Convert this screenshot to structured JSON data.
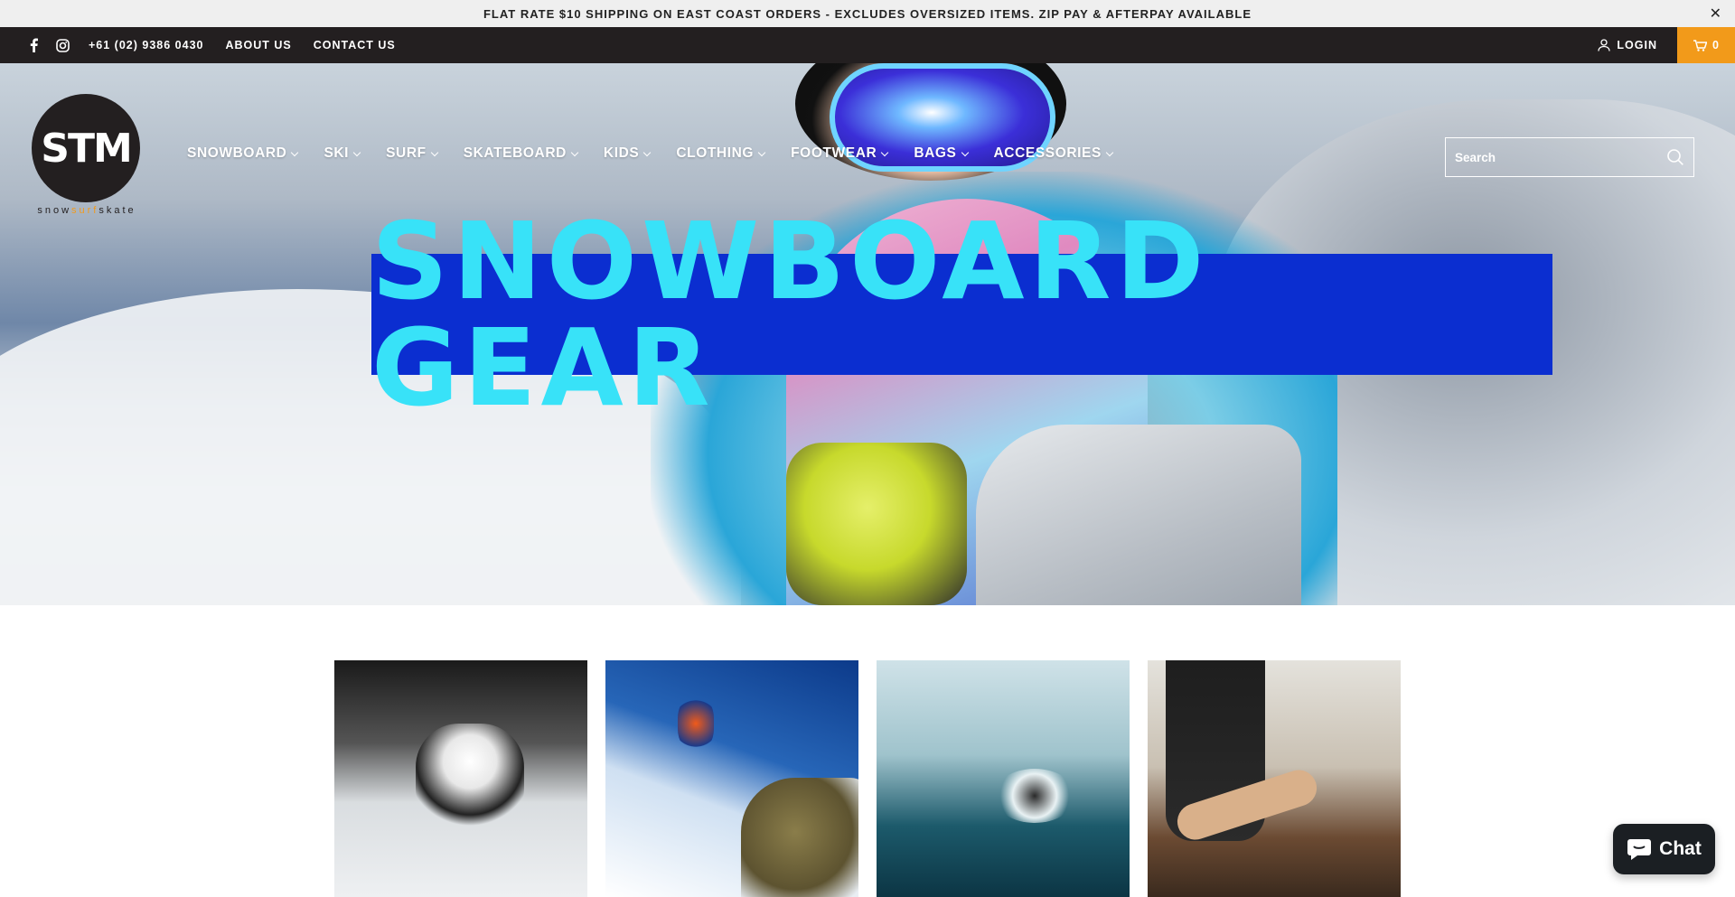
{
  "announcement": {
    "text": "FLAT RATE $10 SHIPPING ON EAST COAST ORDERS - EXCLUDES OVERSIZED ITEMS. ZIP PAY & AFTERPAY AVAILABLE",
    "close_glyph": "✕"
  },
  "topbar": {
    "social": [
      "facebook-icon",
      "instagram-icon"
    ],
    "phone": "+61 (02) 9386 0430",
    "links": [
      "ABOUT US",
      "CONTACT US"
    ],
    "login_label": "LOGIN",
    "cart_count": "0",
    "cart_color": "#f29a1a"
  },
  "logo": {
    "mark": "STM",
    "tag_snow": "snow",
    "tag_surf": "surf",
    "tag_skate": "skate"
  },
  "nav": {
    "items": [
      "SNOWBOARD",
      "SKI",
      "SURF",
      "SKATEBOARD",
      "KIDS",
      "CLOTHING",
      "FOOTWEAR",
      "BAGS",
      "ACCESSORIES"
    ]
  },
  "search": {
    "placeholder": "Search",
    "icon": "search-icon"
  },
  "hero": {
    "banner_text": "SNOWBOARD GEAR",
    "banner_bg": "#0b2ed0",
    "banner_fg": "#38e2f8"
  },
  "tiles": [
    "ski",
    "snowboard",
    "surf",
    "skateboard"
  ],
  "chat": {
    "label": "Chat"
  }
}
